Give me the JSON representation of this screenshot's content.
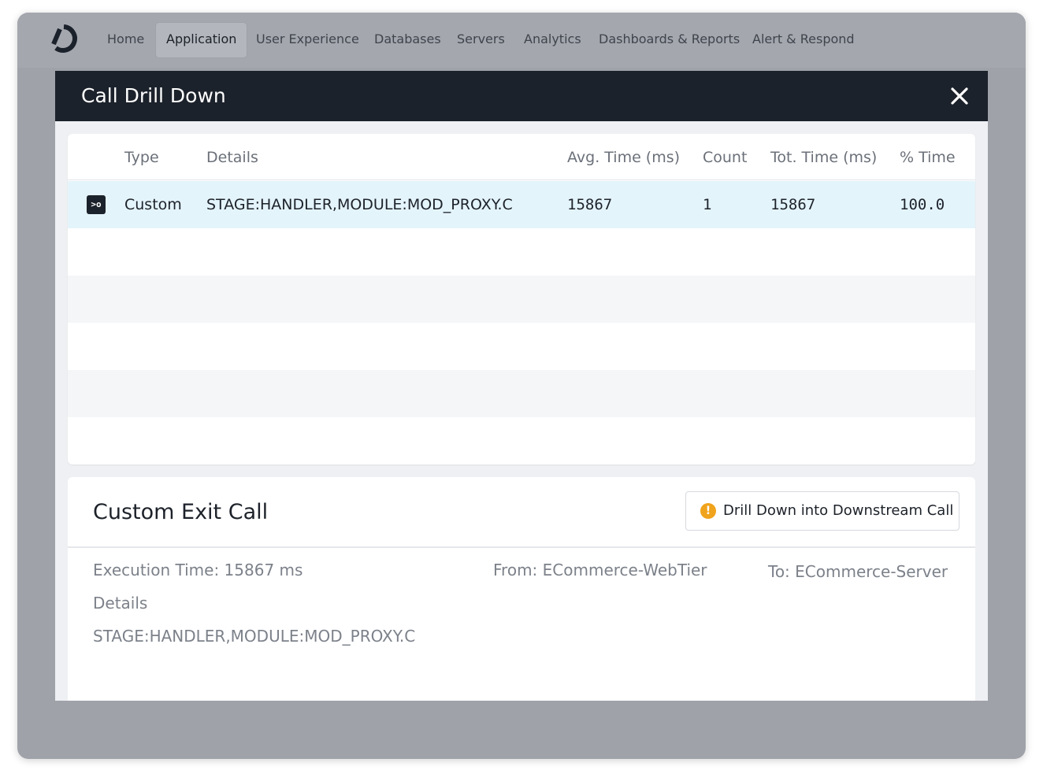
{
  "nav": {
    "items": [
      {
        "label": "Home"
      },
      {
        "label": "Application"
      },
      {
        "label": "User Experience"
      },
      {
        "label": "Databases"
      },
      {
        "label": "Servers"
      },
      {
        "label": "Analytics"
      },
      {
        "label": "Dashboards & Reports"
      },
      {
        "label": "Alert & Respond"
      }
    ],
    "active": "Application"
  },
  "modal": {
    "title": "Call Drill Down",
    "close_icon": "close-icon"
  },
  "table": {
    "headers": {
      "type": "Type",
      "details": "Details",
      "avg_time": "Avg. Time (ms)",
      "count": "Count",
      "tot_time": "Tot. Time (ms)",
      "pct_time": "% Time"
    },
    "rows": [
      {
        "icon": "custom-exit-icon",
        "icon_glyph": ">o",
        "type": "Custom",
        "details": "STAGE:HANDLER,MODULE:MOD_PROXY.C",
        "avg_time": "15867",
        "count": "1",
        "tot_time": "15867",
        "pct_time": "100.0"
      }
    ]
  },
  "detail": {
    "title": "Custom Exit Call",
    "drill_button": "Drill Down into Downstream Call",
    "drill_icon_glyph": "!",
    "execution_time": "Execution Time: 15867 ms",
    "from": "From: ECommerce-WebTier",
    "to": "To: ECommerce-Server",
    "details_label": "Details",
    "details_value": "STAGE:HANDLER,MODULE:MOD_PROXY.C"
  },
  "colors": {
    "header_bg": "#1c222b",
    "selected_row": "#e4f4fb",
    "warning": "#f0a31c",
    "overlay": "#9fa2a9"
  }
}
